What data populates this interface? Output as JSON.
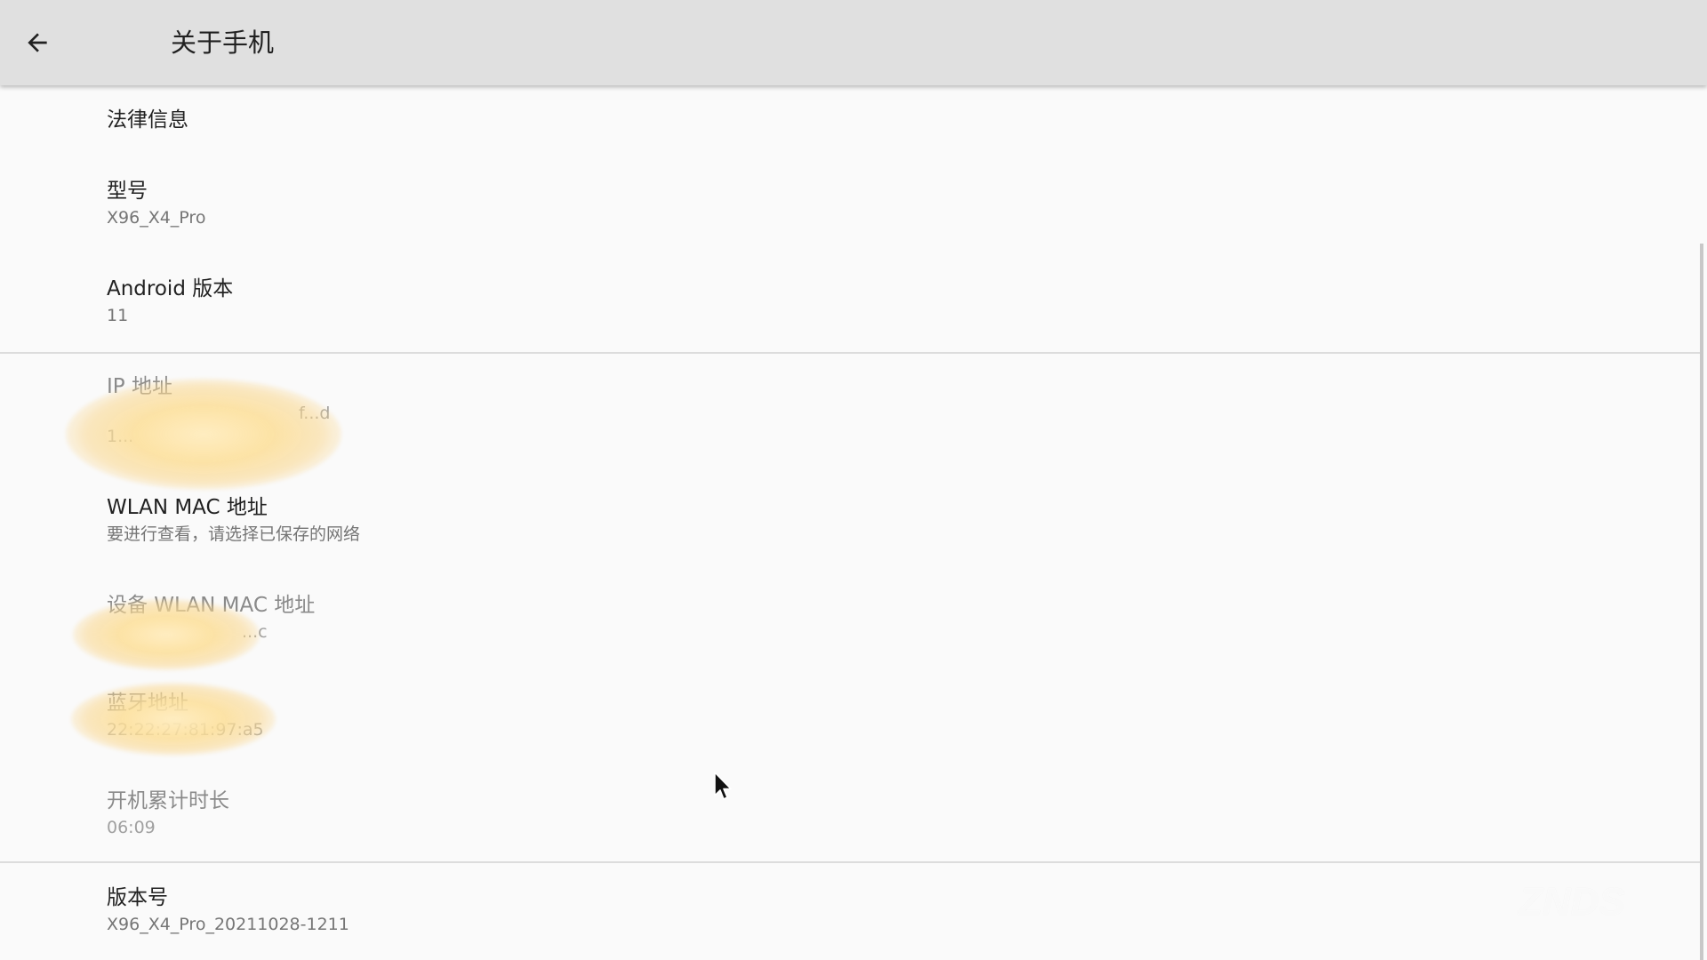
{
  "header": {
    "back_icon": "arrow-back-icon",
    "title": "关于手机"
  },
  "items": [
    {
      "title": "法律信息",
      "summary": null
    },
    {
      "title": "型号",
      "summary": "X96_X4_Pro"
    },
    {
      "title": "Android 版本",
      "summary": "11"
    },
    {
      "title": "IP 地址",
      "summary_line1": "f...d",
      "summary_line2": "1..."
    },
    {
      "title": "WLAN MAC 地址",
      "summary": "要进行查看，请选择已保存的网络"
    },
    {
      "title": "设备 WLAN MAC 地址",
      "summary": "...c"
    },
    {
      "title": "蓝牙地址",
      "summary": "22:22:27:81:97:a5"
    },
    {
      "title": "开机累计时长",
      "summary": "06:09"
    },
    {
      "title": "版本号",
      "summary": "X96_X4_Pro_20211028-1211"
    }
  ],
  "colors": {
    "app_bar": "#e0e0e0",
    "background": "#fafafa",
    "redaction": "#f7d68a"
  },
  "watermark": "ZNDS"
}
